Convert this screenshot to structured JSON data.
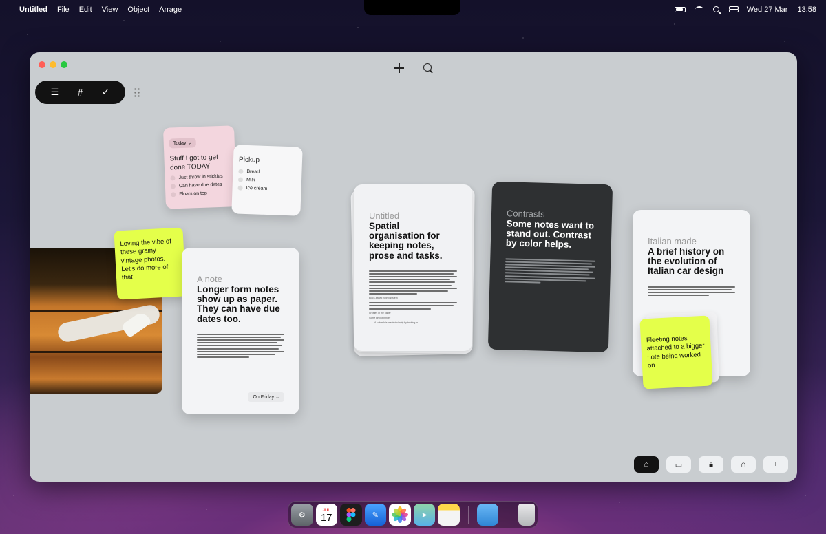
{
  "menubar": {
    "app_name": "Untitled",
    "menus": [
      "File",
      "Edit",
      "View",
      "Object",
      "Arrage"
    ],
    "date": "Wed 27 Mar",
    "time": "13:58"
  },
  "toolbar": {
    "icons": [
      "list-icon",
      "hashtag-icon",
      "checkmark-icon"
    ],
    "glyphs": [
      "☰",
      "#",
      "✓"
    ]
  },
  "pink_note": {
    "chip": "Today ⌄",
    "title": "Stuff I got to get done TODAY",
    "items": [
      "Just throw in stickies",
      "Can have due dates",
      "Floats on top"
    ]
  },
  "pickup_note": {
    "title": "Pickup",
    "items": [
      "Bread",
      "Milk",
      "Ice cream"
    ]
  },
  "yellow_note_a": {
    "text": "Loving the vibe of these grainy vintage photos. Let’s do more of that"
  },
  "note_card": {
    "label": "A note",
    "heading": "Longer form notes show up as paper. They can have due dates too.",
    "due": "On Friday ⌄"
  },
  "untitled_card": {
    "label": "Untitled",
    "heading": "Spatial organisation for keeping notes, prose and tasks.",
    "sub1": "Block-based typing system",
    "task1": "Creates in the paper",
    "task2": "Some kind of binder",
    "task3": "A subtask is created simply by tabbing in"
  },
  "contrast_card": {
    "label": "Contrasts",
    "heading": "Some notes want to stand out. Contrast by color helps."
  },
  "italian_card": {
    "label": "Italian made",
    "heading": "A brief history on the evolution of Italian car design"
  },
  "yellow_note_b": {
    "text": "Fleeting notes attached to a bigger note being worked on"
  },
  "bottom_bar": {
    "icons": [
      "home-icon",
      "inbox-icon",
      "lock-icon",
      "headphones-icon",
      "plus-icon"
    ],
    "glyphs": [
      "⌂",
      "▭",
      "🔒︎",
      "∩",
      "+"
    ]
  },
  "dock": {
    "calendar_month": "JUL",
    "calendar_day": "17"
  },
  "colors": {
    "accent_yellow": "#e4ff4a",
    "pink": "#f3d6de",
    "dark_card": "#2e3032",
    "canvas": "#c9cdd0"
  }
}
